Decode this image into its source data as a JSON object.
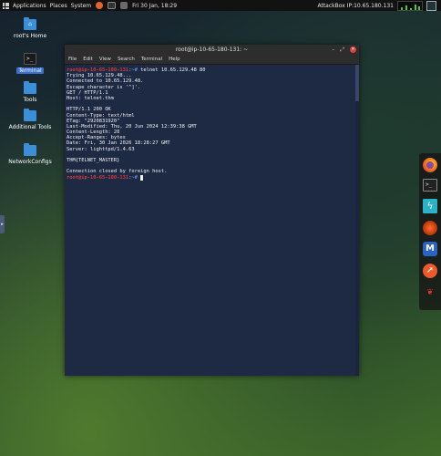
{
  "top_panel": {
    "applications": "Applications",
    "places": "Places",
    "system": "System",
    "datetime": "Fri 30 Jan, 18:29",
    "attackbox_ip": "AttackBox IP:10.65.180.131"
  },
  "desktop_icons": [
    {
      "label": "root's Home",
      "glyph": "⌂"
    },
    {
      "label": "Terminal",
      "glyph": ">_"
    },
    {
      "label": "Tools",
      "glyph": ""
    },
    {
      "label": "Additional Tools",
      "glyph": ""
    },
    {
      "label": "NetworkConfigs",
      "glyph": ""
    }
  ],
  "terminal": {
    "title": "root@ip-10-65-180-131: ~",
    "menu": [
      "File",
      "Edit",
      "View",
      "Search",
      "Terminal",
      "Help"
    ],
    "prompt_user": "root@ip-10-65-180-131",
    "prompt_path": ":~#",
    "command": " telnet 10.65.129.48 80",
    "output": [
      "Trying 10.65.129.48...",
      "Connected to 10.65.129.48.",
      "Escape character is '^]'.",
      "GET / HTTP/1.1",
      "Host: telnet.thm",
      "",
      "HTTP/1.1 200 OK",
      "Content-Type: text/html",
      "ETag: \"2920831920\"",
      "Last-Modified: Thu, 20 Jun 2024 12:39:38 GMT",
      "Content-Length: 20",
      "Accept-Ranges: bytes",
      "Date: Fri, 30 Jan 2026 18:28:27 GMT",
      "Server: lighttpd/1.4.63",
      "",
      "THM{TELNET_MASTER}",
      "",
      "Connection closed by foreign host."
    ]
  },
  "dock": {
    "items": [
      "firefox-icon",
      "terminal-icon",
      "zap-icon",
      "burpsuite-icon",
      "metasploit-icon",
      "compass-icon",
      "dragon-icon"
    ]
  }
}
